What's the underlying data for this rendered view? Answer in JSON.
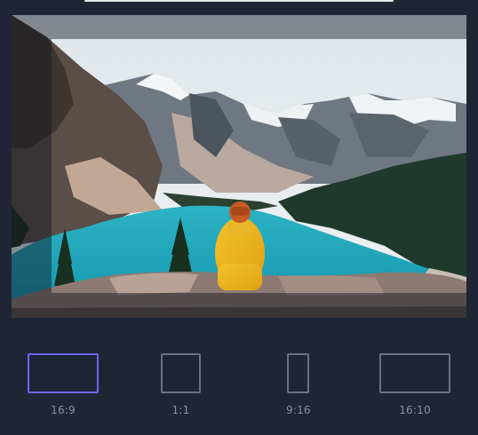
{
  "crop_panel": {
    "photo": {
      "description_icon": "image-preview"
    },
    "ratios": [
      {
        "label": "16:9",
        "selected": true
      },
      {
        "label": "1:1",
        "selected": false
      },
      {
        "label": "9:16",
        "selected": false
      },
      {
        "label": "16:10",
        "selected": false
      }
    ],
    "colors": {
      "background": "#1f2535",
      "selected_accent": "#6c64f2",
      "inactive_border": "#6b7180",
      "label_text": "#8b90a0"
    }
  }
}
